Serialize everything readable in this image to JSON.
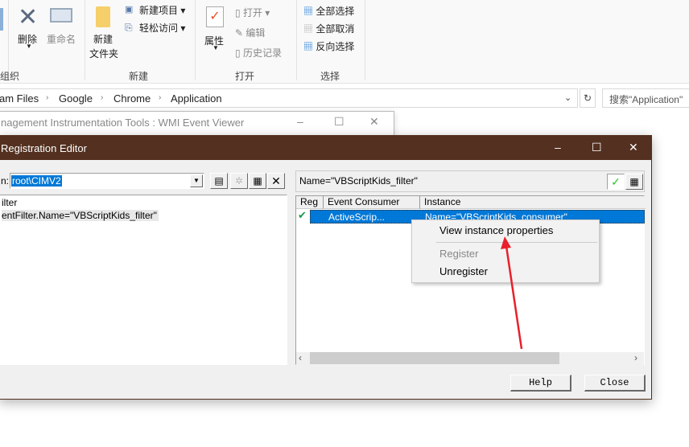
{
  "ribbon": {
    "organize": {
      "delete_label": "删除",
      "rename_label": "重命名",
      "group_label": "组织"
    },
    "new": {
      "new_folder_label_1": "新建",
      "new_folder_label_2": "文件夹",
      "new_item_label": "新建项目",
      "easy_access_label": "轻松访问",
      "group_label": "新建"
    },
    "open": {
      "properties_label": "属性",
      "open_label": "打开",
      "edit_label": "编辑",
      "history_label": "历史记录",
      "group_label": "打开"
    },
    "select": {
      "select_all_label": "全部选择",
      "select_none_label": "全部取消",
      "invert_label": "反向选择",
      "group_label": "选择"
    }
  },
  "address": {
    "crumbs": [
      "am Files",
      "Google",
      "Chrome",
      "Application"
    ],
    "search_placeholder": "搜索\"Application\""
  },
  "event_viewer": {
    "title": "nagement Instrumentation Tools : WMI Event Viewer"
  },
  "registration_editor": {
    "title": "Registration Editor",
    "namespace_label": "n:",
    "namespace_value": "root\\CIMV2",
    "tree": [
      "ilter",
      "entFilter.Name=\"VBScriptKids_filter\""
    ],
    "filter_name": "Name=\"VBScriptKids_filter\"",
    "columns": [
      "Reg",
      "Event Consumer Class",
      "Instance"
    ],
    "rows": [
      {
        "registered": true,
        "class": "ActiveScrip...",
        "instance": "Name=\"VBScriptKids_consumer\""
      }
    ],
    "context_menu": [
      {
        "label": "View instance properties",
        "enabled": true
      },
      {
        "label": "Register",
        "enabled": false
      },
      {
        "label": "Unregister",
        "enabled": true
      }
    ],
    "help_label": "Help",
    "close_label": "Close"
  },
  "colors": {
    "titlebar": "#53301f",
    "selection": "#0078d7",
    "annotation_arrow": "#e8202a"
  }
}
